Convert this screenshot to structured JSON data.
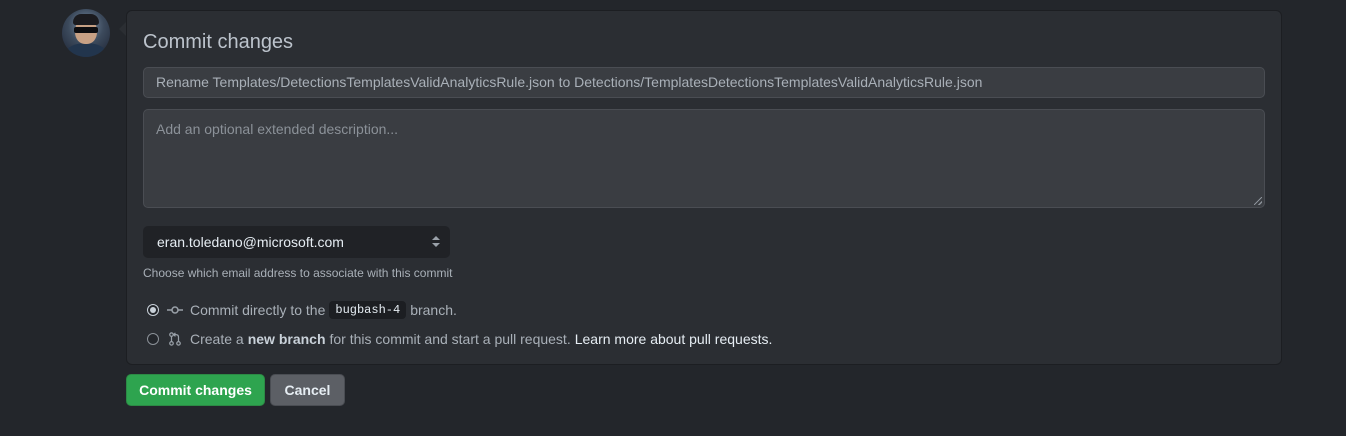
{
  "form": {
    "title": "Commit changes",
    "summary_value": "Rename Templates/DetectionsTemplatesValidAnalyticsRule.json to Detections/TemplatesDetectionsTemplatesValidAnalyticsRule.json",
    "description_placeholder": "Add an optional extended description...",
    "email_selected": "eran.toledano@microsoft.com",
    "email_hint": "Choose which email address to associate with this commit",
    "option_direct": {
      "prefix": "Commit directly to the",
      "branch": "bugbash-4",
      "suffix": "branch.",
      "checked": true,
      "icon": "git-commit-icon"
    },
    "option_new_branch": {
      "prefix": "Create a",
      "bold": "new branch",
      "suffix": "for this commit and start a pull request.",
      "link": "Learn more about pull requests.",
      "checked": false,
      "icon": "git-pull-request-icon"
    }
  },
  "buttons": {
    "commit_label": "Commit changes",
    "cancel_label": "Cancel"
  },
  "colors": {
    "primary": "#2ea44f",
    "background": "#23262b",
    "panel": "#2b2e33"
  }
}
